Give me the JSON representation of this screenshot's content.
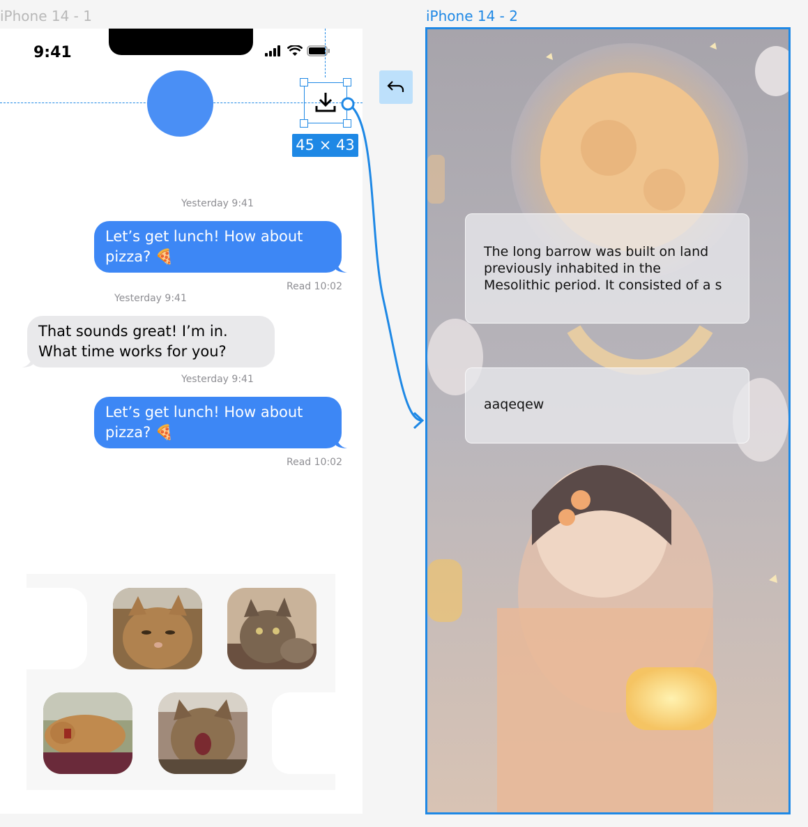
{
  "frames": {
    "frame1_label": "iPhone 14 - 1",
    "frame2_label": "iPhone 14 - 2"
  },
  "status_bar": {
    "time": "9:41"
  },
  "selection": {
    "size_label": "45 × 43"
  },
  "messages": [
    {
      "timestamp": "Yesterday 9:41",
      "text": "Let’s get lunch! How about pizza? 🍕",
      "direction": "outgoing",
      "read": "Read 10:02"
    },
    {
      "timestamp": "Yesterday 9:41",
      "text": "That sounds great! I’m in. What time works for you?",
      "direction": "incoming"
    },
    {
      "timestamp": "Yesterday 9:41",
      "text": "Let’s get lunch! How about pizza? 🍕",
      "direction": "outgoing",
      "read": "Read 10:02"
    }
  ],
  "frame2": {
    "card1_text": "The long barrow was built on land previously inhabited in the Mesolithic period. It consisted of a s",
    "card2_text": "aaqeqew"
  },
  "colors": {
    "accent": "#1e88e5",
    "bubble_out": "#3d87f5",
    "bubble_in": "#e9e9eb",
    "avatar": "#4a8ff5"
  },
  "icons": [
    "download-icon",
    "back-arrow-icon",
    "signal-icon",
    "wifi-icon",
    "battery-icon"
  ]
}
